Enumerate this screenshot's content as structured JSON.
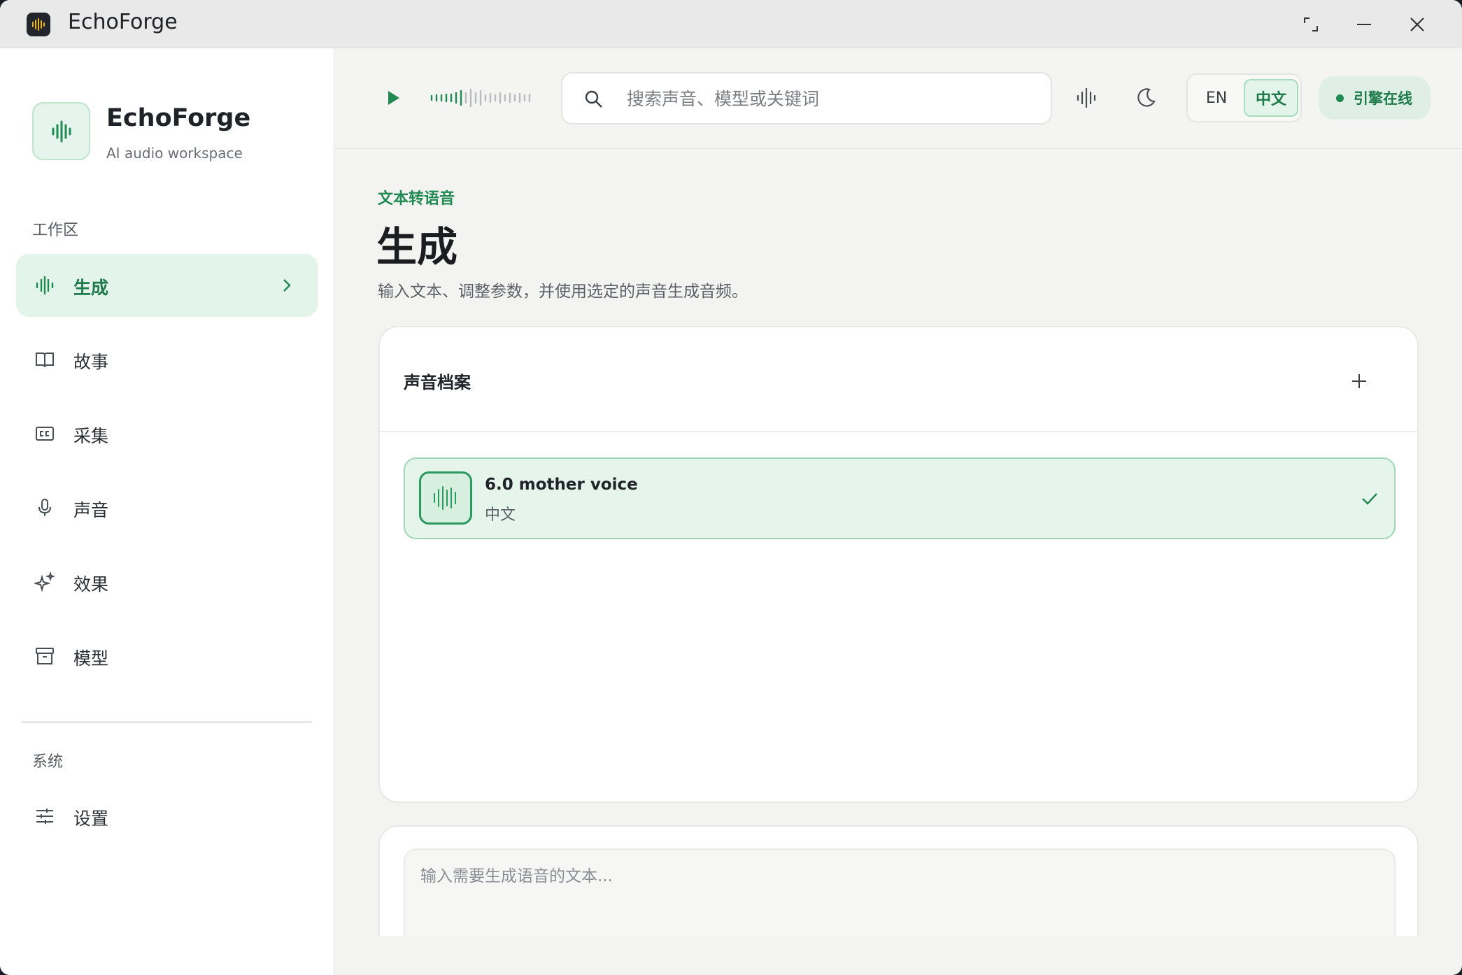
{
  "window": {
    "title": "EchoForge"
  },
  "brand": {
    "name": "EchoForge",
    "subtitle": "AI audio workspace"
  },
  "sidebar": {
    "workspace_label": "工作区",
    "items": [
      {
        "label": "生成",
        "icon": "waveform-icon",
        "active": true
      },
      {
        "label": "故事",
        "icon": "book-icon",
        "active": false
      },
      {
        "label": "采集",
        "icon": "caption-icon",
        "active": false
      },
      {
        "label": "声音",
        "icon": "microphone-icon",
        "active": false
      },
      {
        "label": "效果",
        "icon": "sparkles-icon",
        "active": false
      },
      {
        "label": "模型",
        "icon": "archive-icon",
        "active": false
      }
    ],
    "system_label": "系统",
    "settings_label": "设置"
  },
  "topbar": {
    "search_placeholder": "搜索声音、模型或关键词",
    "lang_en": "EN",
    "lang_zh": "中文",
    "status": "引擎在线"
  },
  "main": {
    "eyebrow": "文本转语音",
    "title": "生成",
    "description": "输入文本、调整参数，并使用选定的声音生成音频。",
    "profiles_title": "声音档案",
    "voice": {
      "name": "6.0 mother voice",
      "language": "中文",
      "selected": true
    },
    "text_placeholder": "输入需要生成语音的文本..."
  },
  "colors": {
    "accent": "#1f8a52",
    "accent_bg": "#e3f4ea",
    "surface": "#ffffff"
  }
}
